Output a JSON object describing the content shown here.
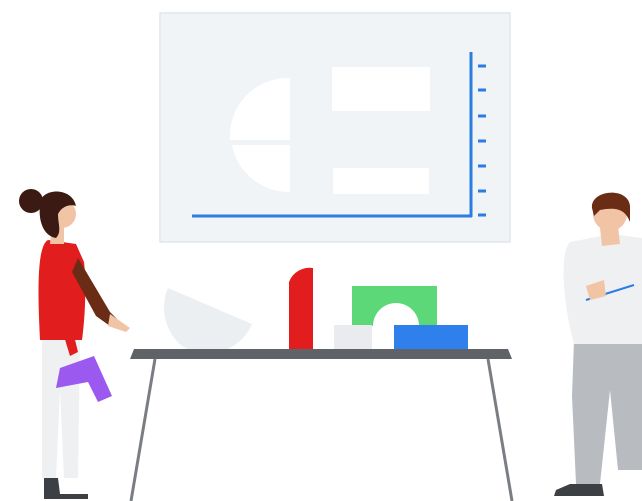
{
  "illustration": {
    "colors": {
      "background": "#ffffff",
      "board": "#f1f4f7",
      "board_border": "#e1e6ec",
      "board_shape": "#ffffff",
      "axis_blue": "#2a7de1",
      "table_top": "#5f6368",
      "table_legs": "#7a7e83",
      "red": "#e11d1d",
      "green": "#5dd879",
      "blue_block": "#2f80ed",
      "grey_block": "#e9ebee",
      "bowl": "#eceff1",
      "purple": "#9b59f0",
      "skin": "#f2c4a6",
      "hair_dark": "#3a1a12",
      "hair_brown": "#6b2c15",
      "shirt_white": "#eef0f2",
      "pants_grey": "#b8bcc0",
      "shoes": "#3c3f43"
    },
    "icons": [
      "whiteboard",
      "presenter-woman",
      "listener-man",
      "table",
      "shape-blocks"
    ]
  }
}
